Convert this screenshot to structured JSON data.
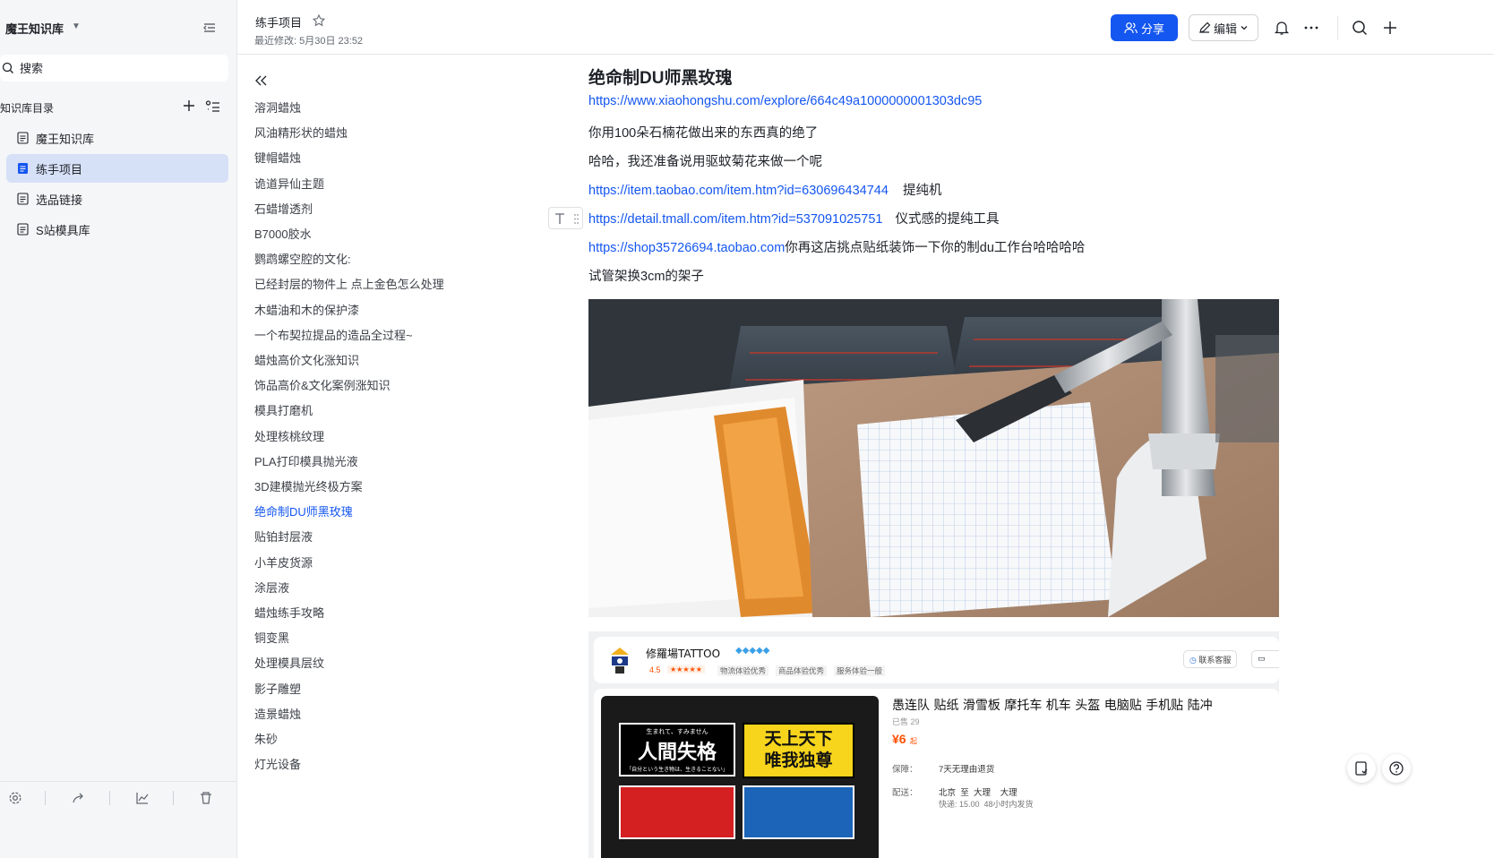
{
  "sidebar": {
    "kb_title": "魔王知识库",
    "search_placeholder": "搜索",
    "dir_label": "知识库目录",
    "items": [
      {
        "label": "魔王知识库"
      },
      {
        "label": "练手项目"
      },
      {
        "label": "选品链接"
      },
      {
        "label": "S站模具库"
      }
    ]
  },
  "header": {
    "doc_name": "练手项目",
    "modified": "最近修改: 5月30日 23:52",
    "share_label": "分享",
    "edit_label": "编辑"
  },
  "toc": [
    "溶洞蜡烛",
    "风油精形状的蜡烛",
    "键帽蜡烛",
    "诡道异仙主题",
    "石蜡增透剂",
    "B7000胶水",
    "鹦鹉螺空腔的文化:",
    "已经封层的物件上 点上金色怎么处理",
    "木蜡油和木的保护漆",
    "一个布契拉提品的造品全过程~",
    "蜡烛高价文化涨知识",
    "饰品高价&文化案例涨知识",
    "模具打磨机",
    "处理核桃纹理",
    "PLA打印模具抛光液",
    "3D建模抛光终极方案",
    "绝命制DU师黑玫瑰",
    "贴铂封层液",
    "小羊皮货源",
    "涂层液",
    "蜡烛练手攻略",
    "铜变黑",
    "处理模具层纹",
    "影子雕塑",
    "造景蜡烛",
    "朱砂",
    "灯光设备"
  ],
  "toc_active_index": 16,
  "content": {
    "title": "绝命制DU师黑玫瑰",
    "link1": "https://www.xiaohongshu.com/explore/664c49a1000000001303dc95",
    "line2": "你用100朵石楠花做出来的东西真的绝了",
    "line3": "哈哈，我还准备说用驱蚊菊花来做一个呢",
    "link4": "https://item.taobao.com/item.htm?id=630696434744",
    "text4": "提纯机",
    "link5": "https://detail.tmall.com/item.htm?id=537091025751",
    "text5": "仪式感的提纯工具",
    "link6": "https://shop35726694.taobao.com",
    "text6": "你再这店挑点贴纸装饰一下你的制du工作台哈哈哈哈",
    "line7": "试管架换3cm的架子"
  },
  "shop": {
    "name": "修羅場TATTOO",
    "rating": "4.5",
    "tags": [
      "物流体验优秀",
      "商品体验优秀",
      "服务体验一般"
    ],
    "contact": "联系客服",
    "product_title": "愚连队 贴纸 滑雪板 摩托车 机车 头盔 电脑贴 手机贴 陆冲",
    "sold": "已售 29",
    "price": "¥6",
    "price_suffix": "起",
    "guarantee_label": "保障：",
    "guarantee": "7天无理由退货",
    "delivery_label": "配送：",
    "delivery": "北京  至  大理    大理",
    "delivery_time": "快递: 15.00  48小时内发货",
    "sticker1": "人間失格",
    "sticker2a": "天上天下",
    "sticker2b": "唯我独尊",
    "sticker1_small": "生まれて、すみません",
    "sticker1_sub": "「自分という生き物は、生きることない」"
  }
}
